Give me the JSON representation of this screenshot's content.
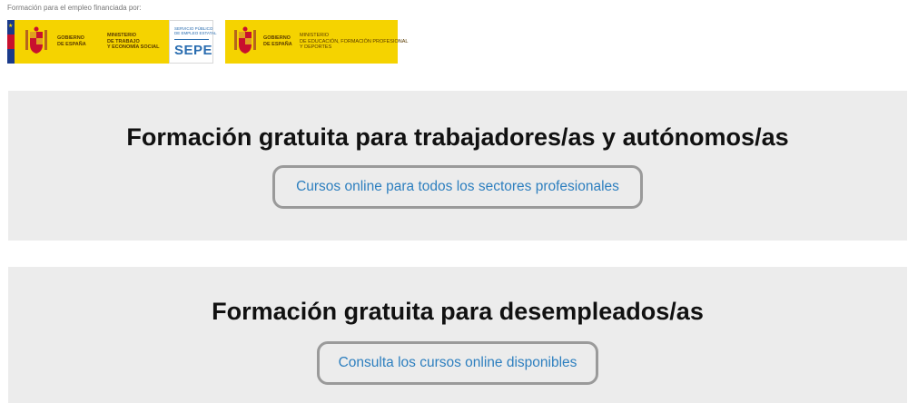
{
  "funding": {
    "caption": "Formación para el empleo financiada por:",
    "logo_left": {
      "gobierno": "GOBIERNO\nDE ESPAÑA",
      "ministerio": "MINISTERIO\nDE TRABAJO\nY ECONOMÍA SOCIAL",
      "sepe_small": "SERVICIO PÚBLICO\nDE EMPLEO ESTATAL",
      "sepe_big": "SEPE"
    },
    "logo_right": {
      "gobierno": "GOBIERNO\nDE ESPAÑA",
      "ministerio": "MINISTERIO\nDE EDUCACIÓN, FORMACIÓN PROFESIONAL\nY DEPORTES"
    }
  },
  "sections": [
    {
      "title": "Formación gratuita para trabajadores/as y autónomos/as",
      "button_label": "Cursos online para todos los sectores profesionales"
    },
    {
      "title": "Formación gratuita para desempleados/as",
      "button_label": "Consulta los cursos online disponibles"
    }
  ],
  "colors": {
    "band_background": "#ececec",
    "button_text": "#2d7fbf",
    "button_border": "#9a9a9a",
    "logo_yellow": "#f5d300"
  }
}
